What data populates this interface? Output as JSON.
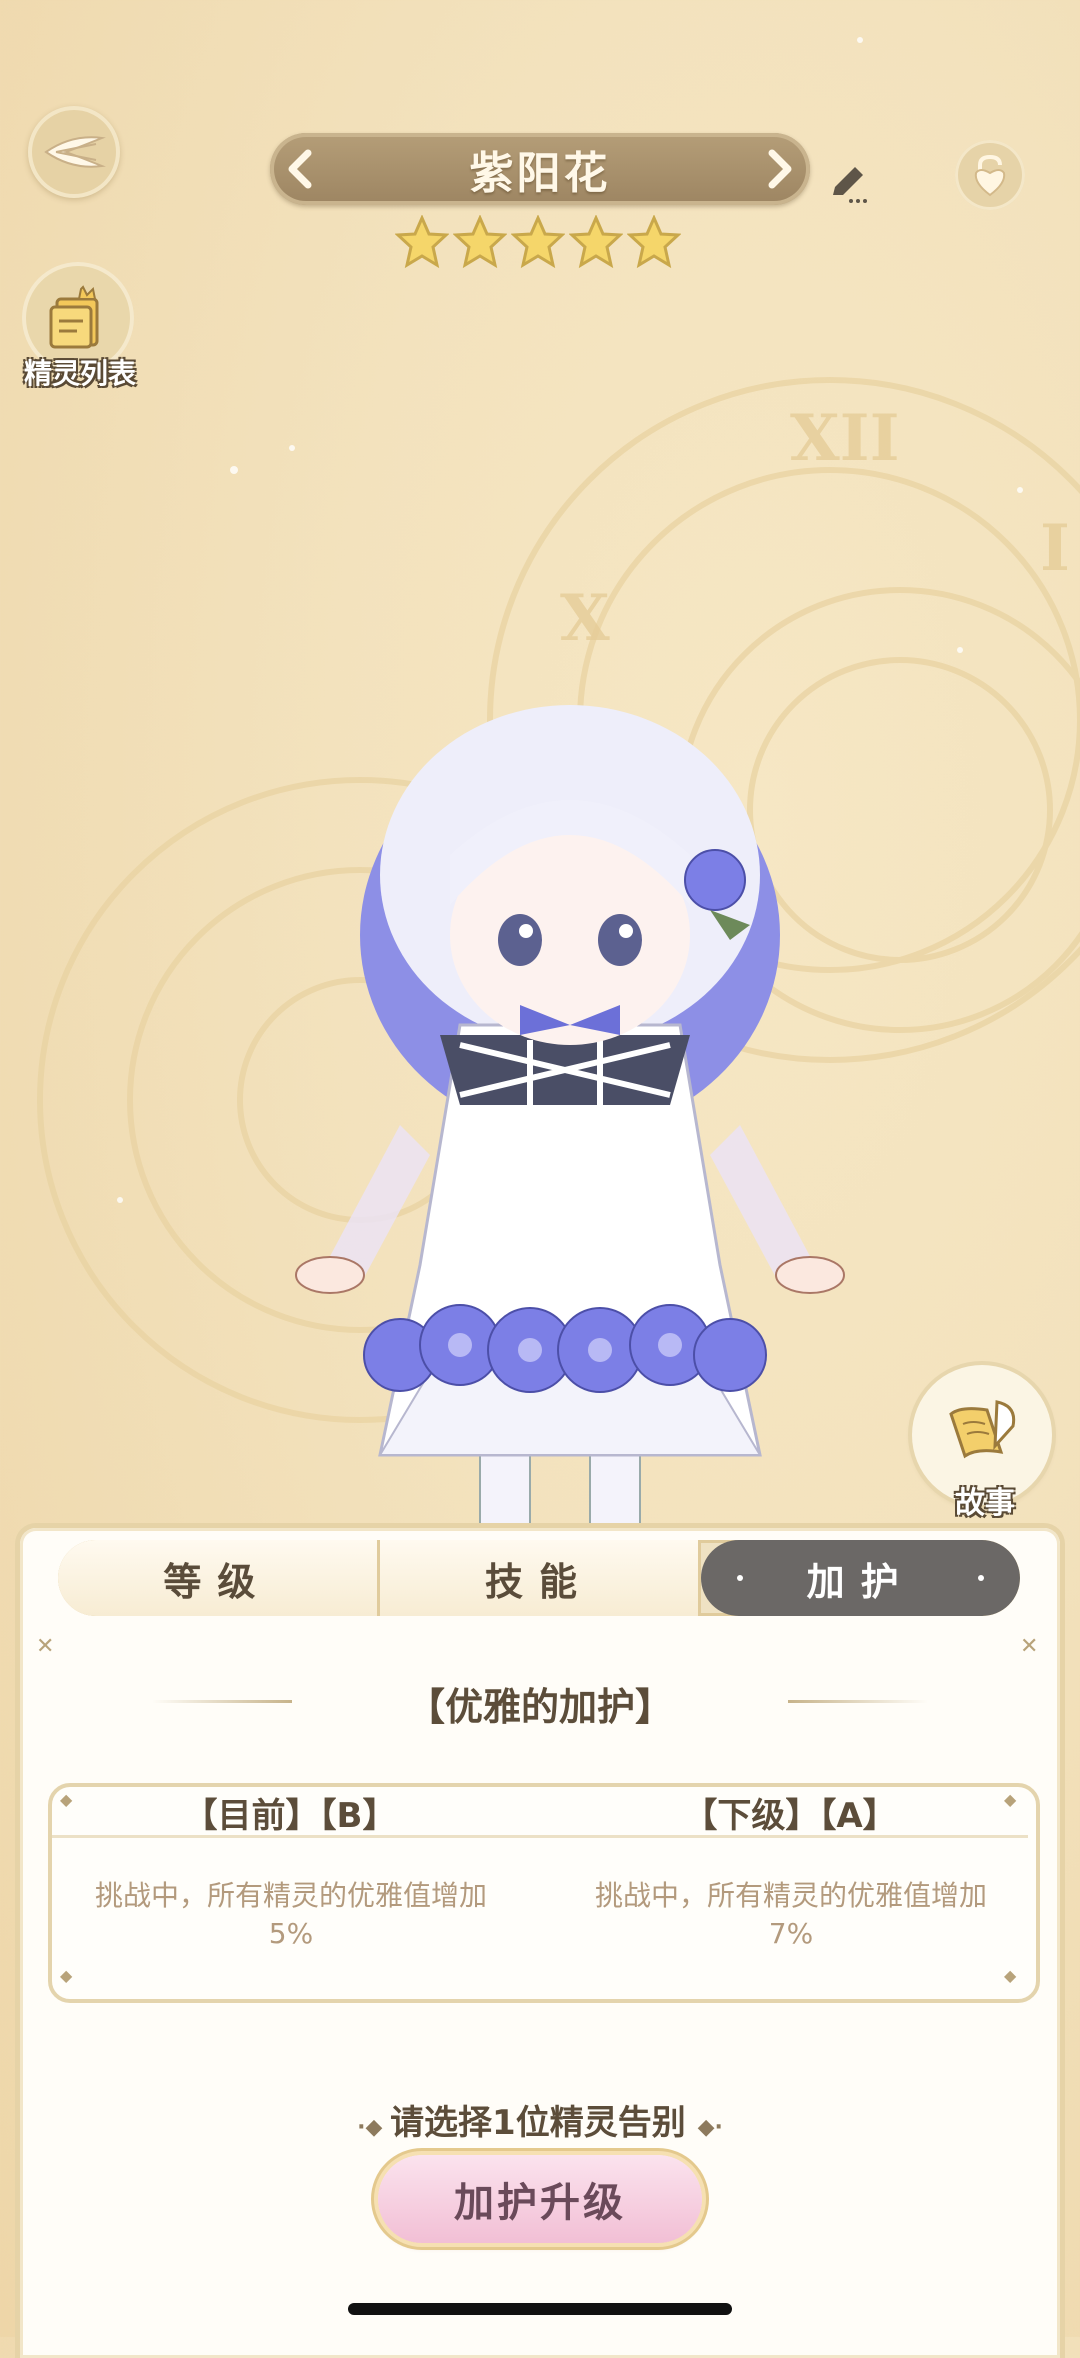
{
  "header": {
    "title": "紫阳花",
    "star_count": 5,
    "star_max": 5
  },
  "side": {
    "list_label": "精灵列表",
    "story_label": "故事"
  },
  "tabs": [
    {
      "label": "等级",
      "active": false
    },
    {
      "label": "技能",
      "active": false
    },
    {
      "label": "加护",
      "active": true
    }
  ],
  "blessing": {
    "title": "【优雅的加护】",
    "current_head": "【目前】【B】",
    "next_head": "【下级】【A】",
    "current_text_line1": "挑战中，所有精灵的优雅值增加",
    "current_text_line2": "5%",
    "next_text_line1": "挑战中，所有精灵的优雅值增加",
    "next_text_line2": "7%"
  },
  "footer": {
    "prompt": "请选择1位精灵告别",
    "upgrade_label": "加护升级"
  },
  "colors": {
    "background": "#f3e2bd",
    "tab_active": "#6b6866",
    "button_pink": "#f2bfd5",
    "character_purple": "#7d80e0"
  }
}
